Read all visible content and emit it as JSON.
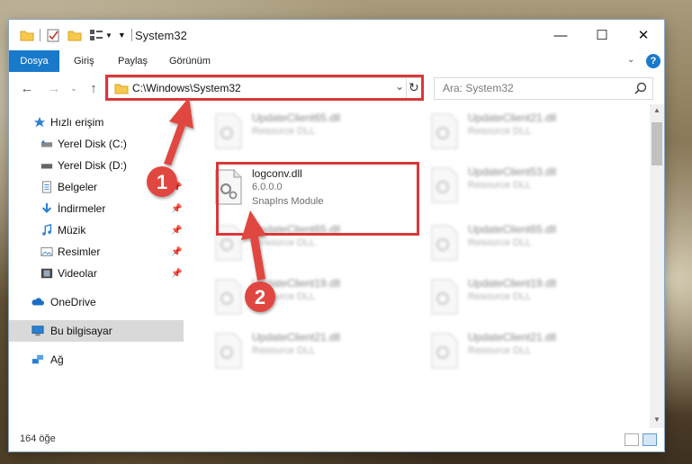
{
  "window": {
    "title": "System32",
    "controls": {
      "minimize": "—",
      "maximize": "☐",
      "close": "✕"
    }
  },
  "ribbon": {
    "tabs": [
      "Dosya",
      "Giriş",
      "Paylaş",
      "Görünüm"
    ],
    "collapse_icon": "chevron-down-icon",
    "help_icon": "help-icon",
    "help_label": "?"
  },
  "address": {
    "path": "C:\\Windows\\System32",
    "refresh_icon": "refresh-icon"
  },
  "search": {
    "placeholder": "Ara: System32"
  },
  "sidebar": {
    "items": [
      {
        "label": "Hızlı erişim",
        "icon": "star-icon"
      },
      {
        "label": "Yerel Disk (C:)",
        "icon": "drive-icon"
      },
      {
        "label": "Yerel Disk (D:)",
        "icon": "drive-icon"
      },
      {
        "label": "Belgeler",
        "icon": "documents-icon"
      },
      {
        "label": "İndirmeler",
        "icon": "download-icon"
      },
      {
        "label": "Müzik",
        "icon": "music-icon"
      },
      {
        "label": "Resimler",
        "icon": "pictures-icon"
      },
      {
        "label": "Videolar",
        "icon": "videos-icon"
      },
      {
        "label": "OneDrive",
        "icon": "cloud-icon"
      },
      {
        "label": "Bu bilgisayar",
        "icon": "computer-icon"
      },
      {
        "label": "Ağ",
        "icon": "network-icon"
      }
    ]
  },
  "files": [
    {
      "name": "UpdateClient65.dll",
      "desc": "Resource DLL"
    },
    {
      "name": "UpdateClient21.dll",
      "desc": "Resource DLL"
    },
    {
      "name": "logconv.dll",
      "desc": "6.0.0.0",
      "sub": "SnapIns Module"
    },
    {
      "name": "UpdateClient53.dll",
      "desc": "Resource DLL"
    },
    {
      "name": "UpdateClient65.dll",
      "desc": "Resource DLL"
    },
    {
      "name": "UpdateClient65.dll",
      "desc": "Resource DLL"
    },
    {
      "name": "UpdateClient65.dll",
      "desc": "Resource DLL"
    },
    {
      "name": "UpdateClient19.dll",
      "desc": "Resource DLL"
    },
    {
      "name": "UpdateClient19.dll",
      "desc": "Resource DLL"
    },
    {
      "name": "UpdateClient21.dll",
      "desc": "Resource DLL"
    },
    {
      "name": "UpdateClient21.dll",
      "desc": "Resource DLL"
    }
  ],
  "status": {
    "count": "164 öğe"
  },
  "annotations": {
    "step1": "1",
    "step2": "2",
    "accent": "#d9383a"
  }
}
